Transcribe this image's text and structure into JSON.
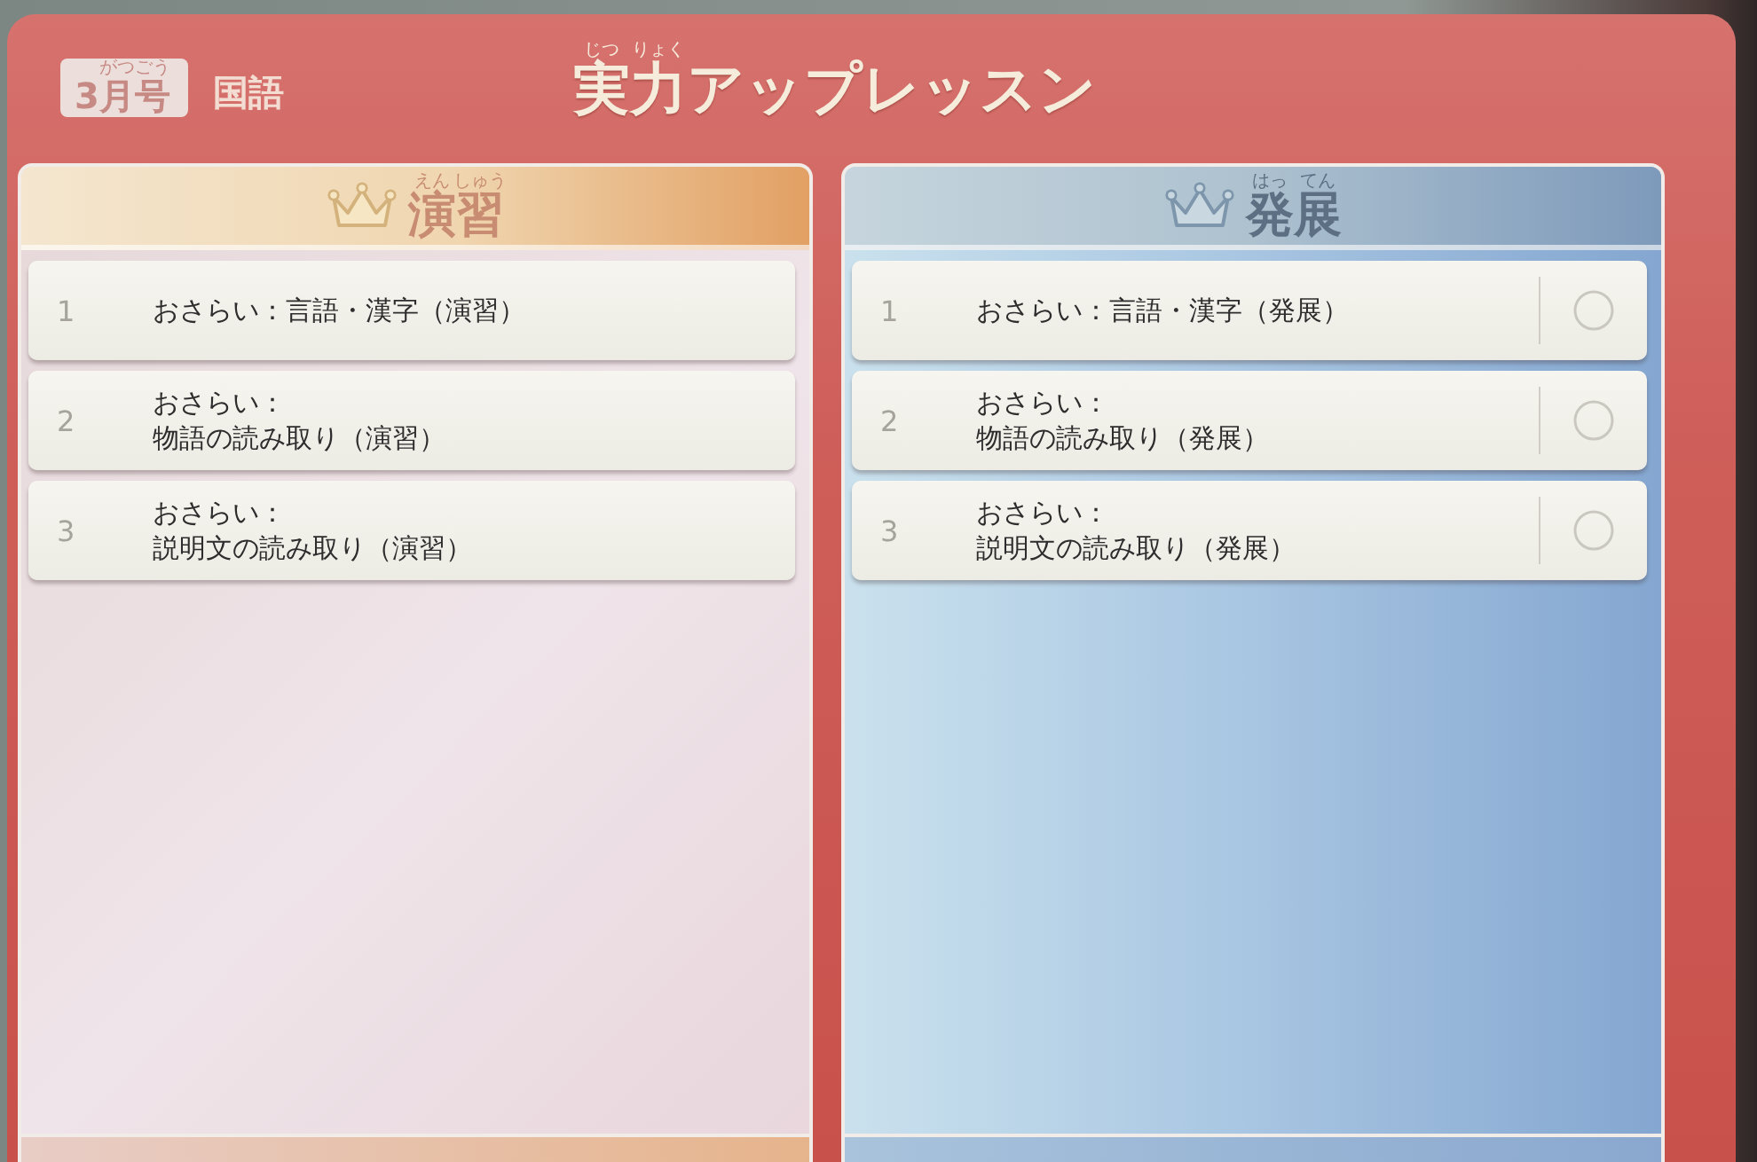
{
  "header": {
    "issue": {
      "text": "3月号",
      "furigana": [
        "がつ",
        "ごう"
      ]
    },
    "subject": "国語",
    "title": {
      "text": "実力アップレッスン",
      "furigana": [
        "じつ",
        "りょく"
      ]
    }
  },
  "panels": [
    {
      "kind": "practice",
      "title": {
        "text": "演習",
        "furigana": [
          "えん",
          "しゅう"
        ]
      },
      "items": [
        {
          "number": "1",
          "lines": [
            "おさらい：言語・漢字（演習）"
          ]
        },
        {
          "number": "2",
          "lines": [
            "おさらい：",
            "物語の読み取り（演習）"
          ]
        },
        {
          "number": "3",
          "lines": [
            "おさらい：",
            "説明文の読み取り（演習）"
          ]
        }
      ]
    },
    {
      "kind": "advanced",
      "title": {
        "text": "発展",
        "furigana": [
          "はっ",
          "てん"
        ]
      },
      "items": [
        {
          "number": "1",
          "lines": [
            "おさらい：言語・漢字（発展）"
          ],
          "done": false
        },
        {
          "number": "2",
          "lines": [
            "おさらい：",
            "物語の読み取り（発展）"
          ],
          "done": false
        },
        {
          "number": "3",
          "lines": [
            "おさらい：",
            "説明文の読み取り（発展）"
          ],
          "done": false
        }
      ]
    }
  ]
}
